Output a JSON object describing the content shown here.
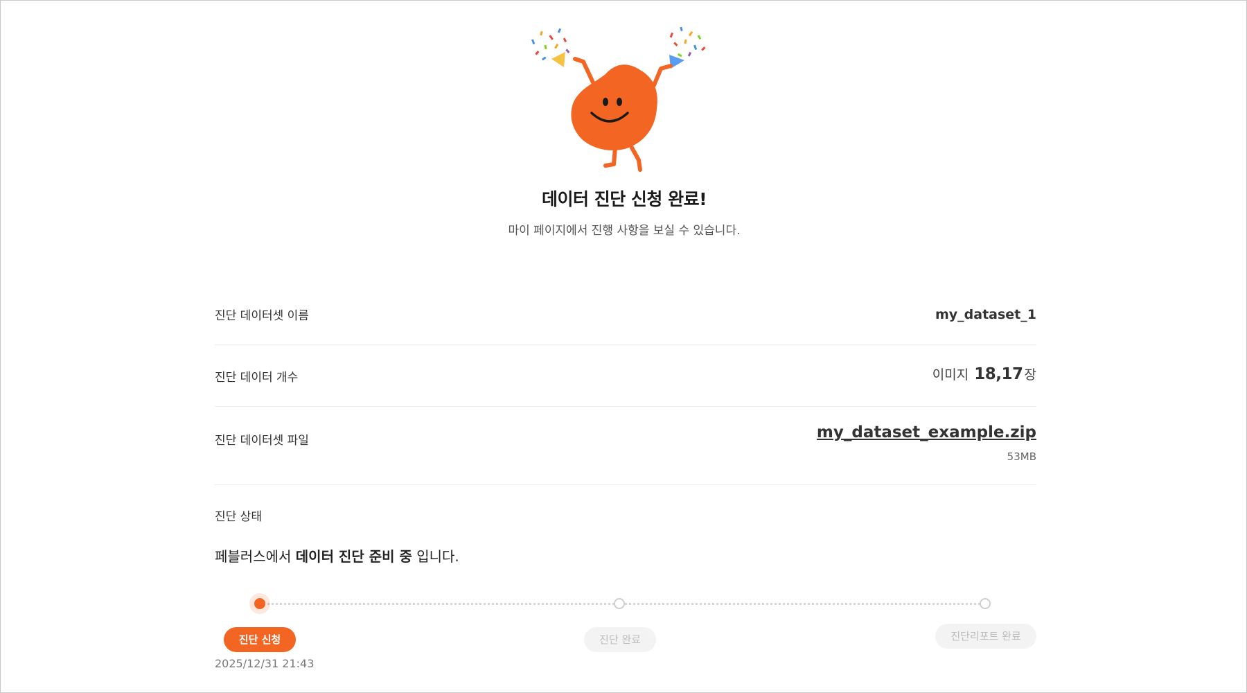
{
  "header": {
    "title": "데이터 진단 신청 완료!",
    "subtitle": "마이 페이지에서 진행 사항을 보실 수 있습니다."
  },
  "details": {
    "dataset_name": {
      "label": "진단 데이터셋 이름",
      "value": "my_dataset_1"
    },
    "data_count": {
      "label": "진단 데이터 개수",
      "prefix": "이미지",
      "value": "18,17",
      "unit": "장"
    },
    "dataset_file": {
      "label": "진단 데이터셋 파일",
      "file_name": "my_dataset_example.zip",
      "file_size": "53MB"
    }
  },
  "status": {
    "label": "진단 상태",
    "message_prefix": "페블러스에서 ",
    "message_bold": "데이터 진단 준비 중",
    "message_suffix": " 입니다.",
    "steps": [
      {
        "label": "진단 신청",
        "active": true,
        "date": "2025/12/31 21:43"
      },
      {
        "label": "진단 완료",
        "active": false
      },
      {
        "label": "진단리포트 완료",
        "active": false
      }
    ]
  },
  "colors": {
    "accent": "#f26522",
    "mascot_body": "#f26522",
    "idle_step": "#cfcfcf"
  },
  "icons": {
    "mascot": "celebrating-blob-mascot",
    "confetti_left": "party-popper-yellow",
    "confetti_right": "party-popper-blue"
  }
}
